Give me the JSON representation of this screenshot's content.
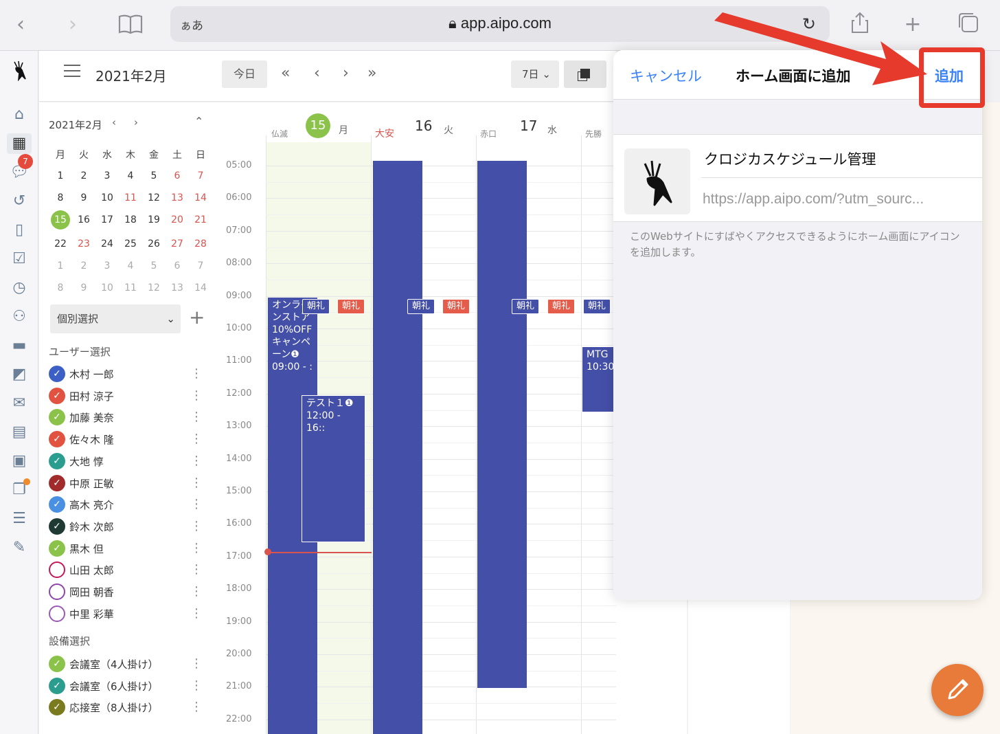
{
  "browser": {
    "aa": "ぁあ",
    "url": "app.aipo.com"
  },
  "nav": {
    "badge": "7"
  },
  "toolbar": {
    "title": "2021年2月",
    "today": "今日",
    "prev_week": "«",
    "prev": "‹",
    "next": "›",
    "next_week": "»",
    "range": "7日"
  },
  "mini_calendar": {
    "title": "2021年2月",
    "weekdays": [
      "月",
      "火",
      "水",
      "木",
      "金",
      "土",
      "日"
    ],
    "rows": [
      [
        "1",
        "2",
        "3",
        "4",
        "5",
        "6",
        "7"
      ],
      [
        "8",
        "9",
        "10",
        "11",
        "12",
        "13",
        "14"
      ],
      [
        "15",
        "16",
        "17",
        "18",
        "19",
        "20",
        "21"
      ],
      [
        "22",
        "23",
        "24",
        "25",
        "26",
        "27",
        "28"
      ],
      [
        "1",
        "2",
        "3",
        "4",
        "5",
        "6",
        "7"
      ],
      [
        "8",
        "9",
        "10",
        "11",
        "12",
        "13",
        "14"
      ]
    ]
  },
  "filter": {
    "select": "個別選択"
  },
  "users": {
    "heading": "ユーザー選択",
    "items": [
      {
        "name": "木村 一郎",
        "color": "#3b5fc4",
        "checked": true
      },
      {
        "name": "田村 涼子",
        "color": "#e15241",
        "checked": true
      },
      {
        "name": "加藤 美奈",
        "color": "#8bc34a",
        "checked": true
      },
      {
        "name": "佐々木 隆",
        "color": "#e15241",
        "checked": true
      },
      {
        "name": "大地 惇",
        "color": "#2a9d8f",
        "checked": true
      },
      {
        "name": "中原 正敏",
        "color": "#a12a2a",
        "checked": true
      },
      {
        "name": "高木 亮介",
        "color": "#4a90e2",
        "checked": true
      },
      {
        "name": "鈴木 次郎",
        "color": "#1f3a33",
        "checked": true
      },
      {
        "name": "黒木 但",
        "color": "#8bc34a",
        "checked": true
      },
      {
        "name": "山田 太郎",
        "color": "#c2185b",
        "checked": false
      },
      {
        "name": "岡田 朝香",
        "color": "#8e44ad",
        "checked": false
      },
      {
        "name": "中里 彩華",
        "color": "#9b59b6",
        "checked": false
      }
    ]
  },
  "facilities": {
    "heading": "設備選択",
    "items": [
      {
        "name": "会議室（4人掛け）",
        "color": "#8bc34a"
      },
      {
        "name": "会議室（6人掛け）",
        "color": "#2a9d8f"
      },
      {
        "name": "応接室（8人掛け）",
        "color": "#7a7a1e"
      }
    ]
  },
  "calendar": {
    "days": [
      {
        "rokuyo": "仏滅",
        "num": "15",
        "wd": "月"
      },
      {
        "rokuyo": "大安",
        "num": "16",
        "wd": "火"
      },
      {
        "rokuyo": "赤口",
        "num": "17",
        "wd": "水"
      },
      {
        "rokuyo": "先勝",
        "num": "",
        "wd": ""
      }
    ],
    "times": [
      "05:00",
      "06:00",
      "07:00",
      "08:00",
      "09:00",
      "10:00",
      "11:00",
      "12:00",
      "13:00",
      "14:00",
      "15:00",
      "16:00",
      "17:00",
      "18:00",
      "19:00",
      "20:00",
      "21:00",
      "22:00"
    ],
    "events": {
      "campaign": "オンラインストア10%OFFキャンペーン❶",
      "campaign_time": "09:00 - :",
      "chorei": "朝礼",
      "test": "テスト１❶",
      "test_time": "12:00 - 16::",
      "mtg": "MTG",
      "mtg_time": "10:30"
    }
  },
  "add_to_home": {
    "cancel": "キャンセル",
    "title": "ホーム画面に追加",
    "add": "追加",
    "app_name": "クロジカスケジュール管理",
    "app_url": "https://app.aipo.com/?utm_sourc...",
    "description": "このWebサイトにすばやくアクセスできるようにホーム画面にアイコンを追加します。"
  },
  "colors": {
    "accent": "#3a82f7",
    "event": "#4450a8",
    "annotation": "#e53a2c",
    "fab": "#e87b3a"
  }
}
